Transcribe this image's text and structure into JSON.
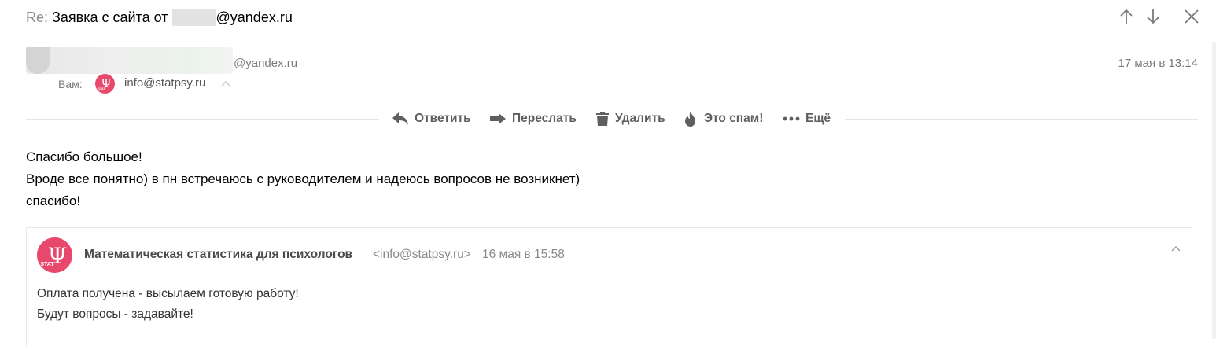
{
  "header": {
    "re_prefix": "Re:",
    "subject_before": "Заявка с сайта от",
    "subject_after": "@yandex.ru"
  },
  "message": {
    "sender_email_suffix": "@yandex.ru",
    "recipients_label": "Вам:",
    "recipient_email": "info@statpsy.ru",
    "date": "17 мая в 13:14",
    "body_lines": [
      "Спасибо большое!",
      "Вроде все понятно) в пн встречаюсь с руководителем и надеюсь вопросов не возникнет)",
      "спасибо!"
    ]
  },
  "toolbar": {
    "reply_label": "Ответить",
    "forward_label": "Переслать",
    "delete_label": "Удалить",
    "spam_label": "Это спам!",
    "more_label": "Ещё"
  },
  "avatar_text": {
    "brand_small": "STAT"
  },
  "quoted": {
    "sender_name": "Математическая статистика для психологов",
    "sender_email": "<info@statpsy.ru>",
    "date": "16 мая в 15:58",
    "body_lines": [
      "Оплата получена - высылаем готовую работу!",
      "Будут вопросы - задавайте!"
    ]
  },
  "colors": {
    "brand_avatar": "#e8486c",
    "toolbar_text": "#5f5f5f",
    "muted_text": "#7a7a7a"
  },
  "icons": [
    "arrow-up-icon",
    "arrow-down-icon",
    "close-icon",
    "reply-icon",
    "forward-icon",
    "trash-icon",
    "fire-icon",
    "more-dots-icon",
    "chevron-up-icon"
  ]
}
